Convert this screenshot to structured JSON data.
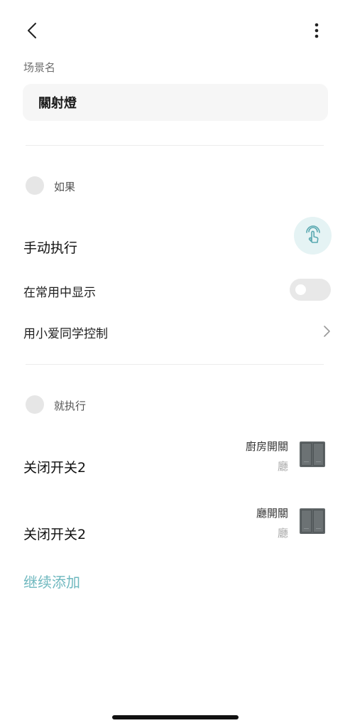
{
  "header": {
    "back_icon": "chevron-left-icon",
    "more_icon": "more-vertical-icon"
  },
  "scene": {
    "label": "场景名",
    "name_value": "關射燈"
  },
  "condition": {
    "label": "如果",
    "trigger_title": "手动执行",
    "trigger_icon": "tap-hand-icon",
    "show_in_common_label": "在常用中显示",
    "show_in_common_enabled": false,
    "xiaoai_label": "用小爱同学控制"
  },
  "action": {
    "label": "就执行",
    "items": [
      {
        "title": "关闭开关2",
        "device_name": "廚房開關",
        "room": "廳",
        "icon": "switch-panel-icon"
      },
      {
        "title": "关闭开关2",
        "device_name": "廳開關",
        "room": "廳",
        "icon": "switch-panel-icon"
      }
    ],
    "add_more_label": "继续添加"
  },
  "colors": {
    "accent": "#6fb8bf",
    "icon_bg": "#e5f3f4"
  }
}
